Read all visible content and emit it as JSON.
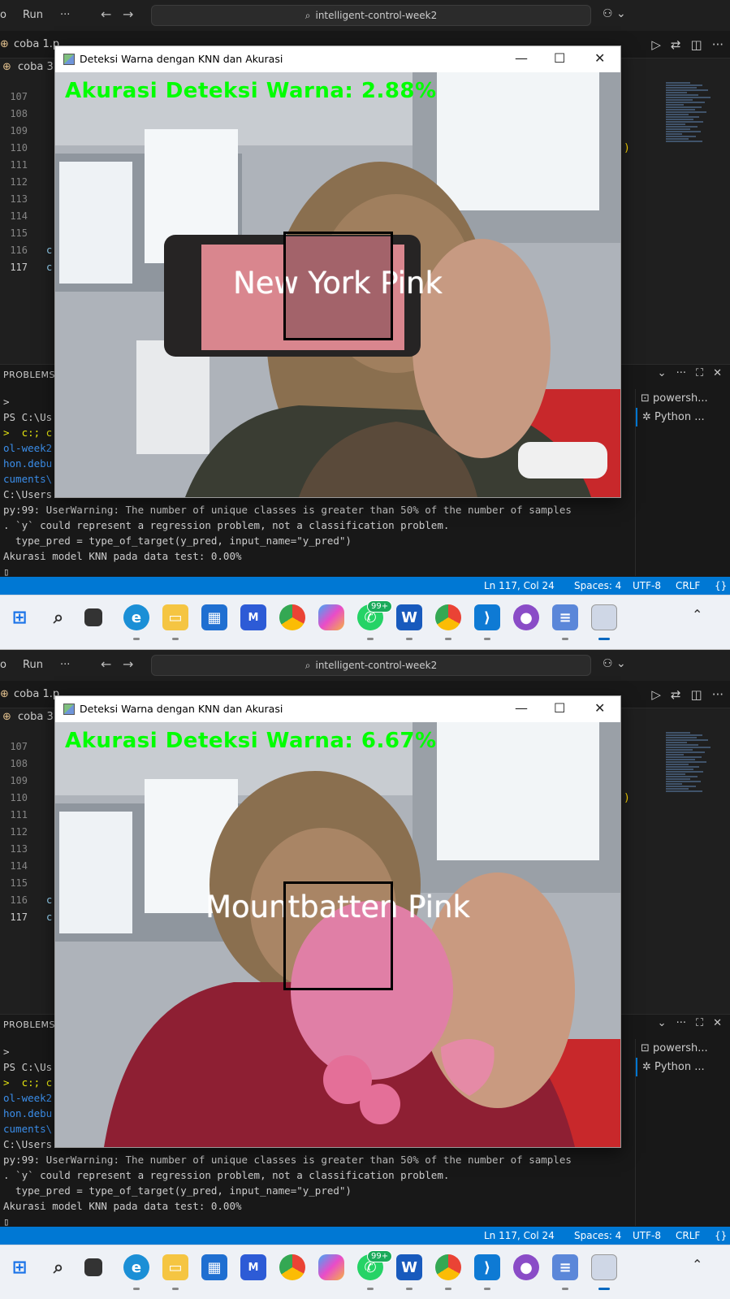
{
  "vscode": {
    "menu_partial": "o",
    "menu_run": "Run",
    "menu_more": "···",
    "search_text": "intelligent-control-week2",
    "editor_tab": "coba 1.p",
    "breadcrumb": "coba 3",
    "line_numbers": [
      "107",
      "108",
      "109",
      "110",
      "111",
      "112",
      "113",
      "114",
      "115",
      "116",
      "117"
    ],
    "code_fragments": {
      "l116": "c",
      "l117": "c",
      "right_brace": ")"
    },
    "panel_title": "PROBLEMS",
    "terminal_lines": [
      ">",
      "PS C:\\Us",
      ">  c:; c",
      "ol-week2",
      "hon.debu",
      "cuments\\",
      "C:\\Users",
      "py:99: UserWarning: The number of unique classes is greater than 50% of the number of samples",
      ". `y` could represent a regression problem, not a classification problem.",
      "  type_pred = type_of_target(y_pred, input_name=\"y_pred\")",
      "Akurasi model KNN pada data test: 0.00%"
    ],
    "terminals": [
      "powersh...",
      "Python ..."
    ],
    "status": {
      "position": "Ln 117, Col 24",
      "spaces": "Spaces: 4",
      "encoding": "UTF-8",
      "eol": "CRLF",
      "lang": "{}"
    },
    "taskbar_badge": "99+"
  },
  "cv_window_title": "Deteksi Warna dengan KNN dan Akurasi",
  "screens": [
    {
      "accuracy": "Akurasi Deteksi Warna: 2.88%",
      "color_name": "New York Pink",
      "swatch": "#d9868e"
    },
    {
      "accuracy": "Akurasi Deteksi Warna: 6.67%",
      "color_name": "Mountbatten Pink",
      "swatch": "#e07fa6"
    }
  ],
  "colors": {
    "accent": "#0078d4",
    "accuracy_text": "#00ff00",
    "status_bg": "#0078d4"
  }
}
